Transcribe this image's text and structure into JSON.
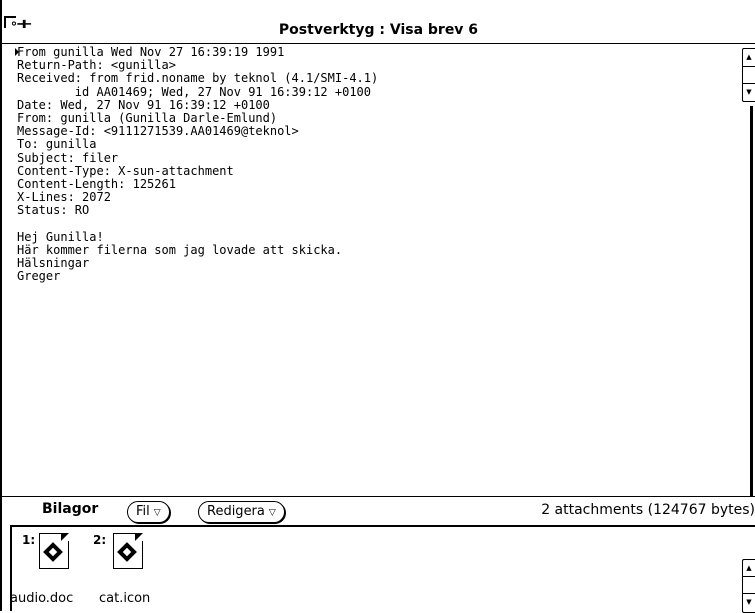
{
  "window": {
    "title": "Postverktyg : Visa brev 6",
    "pin_glyph": "∘⊣⊢"
  },
  "message": {
    "text": "From gunilla Wed Nov 27 16:39:19 1991\nReturn-Path: <gunilla>\nReceived: from frid.noname by teknol (4.1/SMI-4.1)\n        id AA01469; Wed, 27 Nov 91 16:39:12 +0100\nDate: Wed, 27 Nov 91 16:39:12 +0100\nFrom: gunilla (Gunilla Darle-Emlund)\nMessage-Id: <9111271539.AA01469@teknol>\nTo: gunilla\nSubject: filer\nContent-Type: X-sun-attachment\nContent-Length: 125261\nX-Lines: 2072\nStatus: RO\n\nHej Gunilla!\nHär kommer filerna som jag lovade att skicka.\nHälsningar\nGreger"
  },
  "attachments_bar": {
    "heading": "Bilagor",
    "file_menu": "Fil",
    "edit_menu": "Redigera",
    "summary": "2 attachments (124767 bytes)"
  },
  "attachments": [
    {
      "index": "1:",
      "name": "audio.doc",
      "icon": "audio-document-icon"
    },
    {
      "index": "2:",
      "name": "cat.icon",
      "icon": "icon-document-icon"
    }
  ],
  "icons": {
    "scroll_up": "▲",
    "scroll_down": "▼",
    "menu_triangle": "▽"
  }
}
